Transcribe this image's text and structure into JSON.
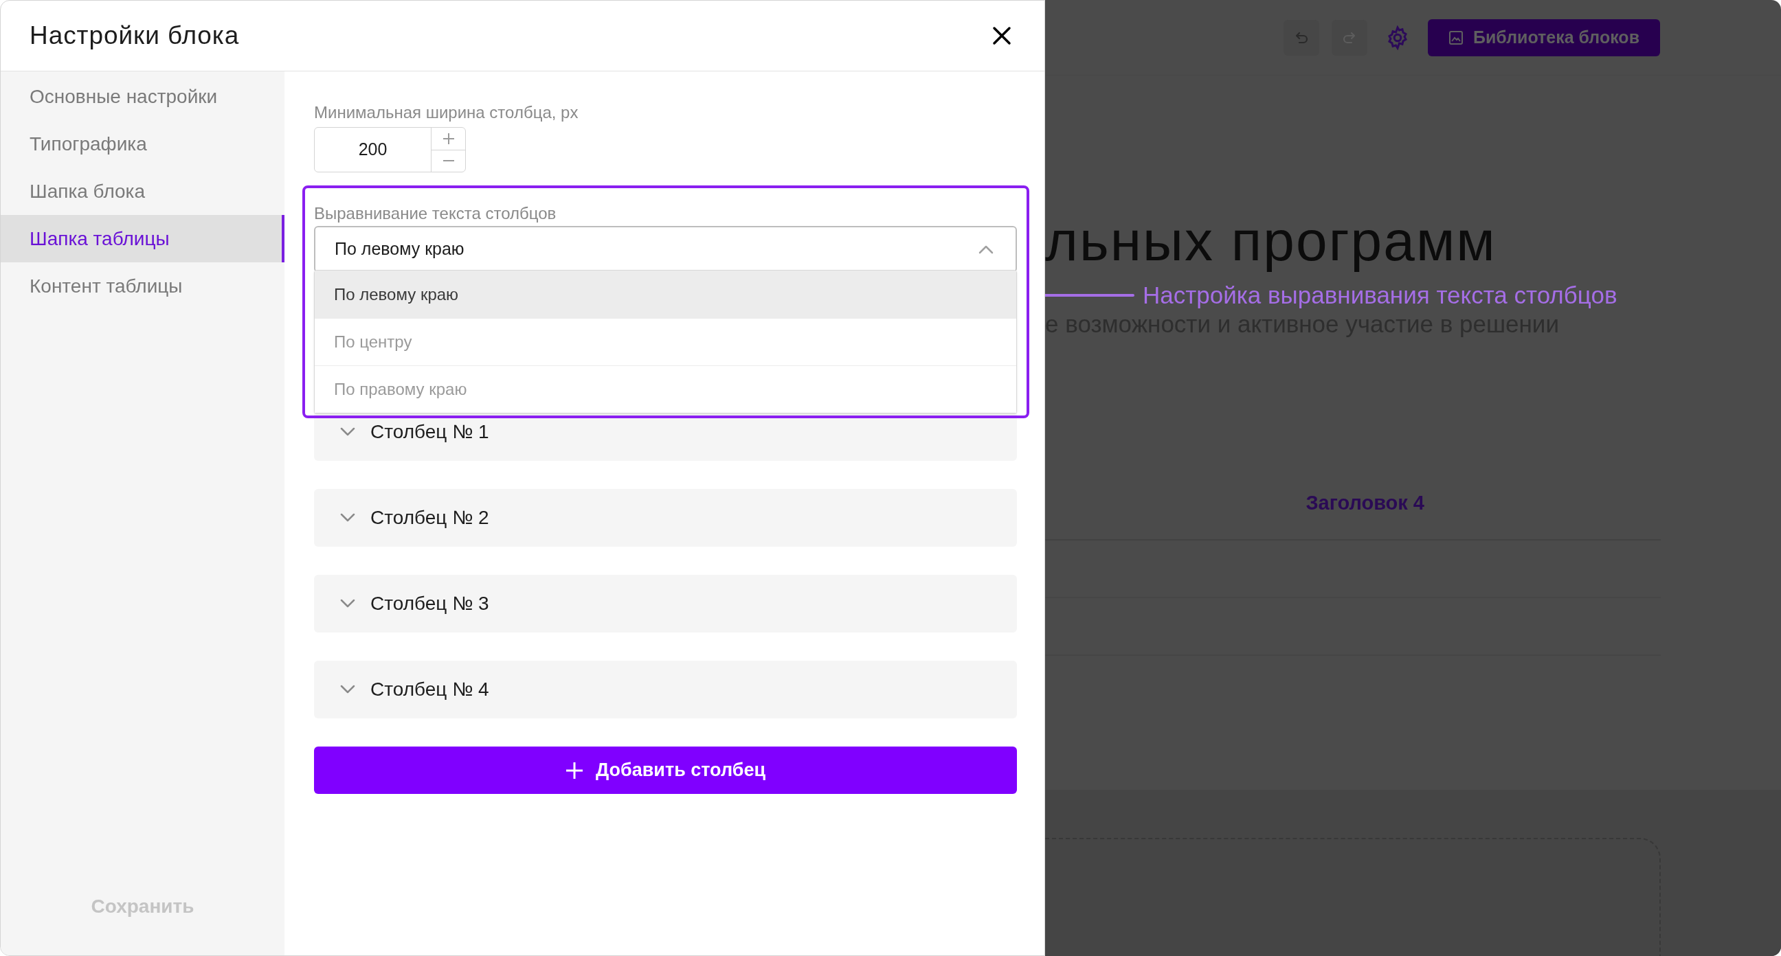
{
  "dialog": {
    "title": "Настройки блока"
  },
  "sidebar": {
    "items": [
      {
        "label": "Основные настройки",
        "selected": false
      },
      {
        "label": "Типографика",
        "selected": false
      },
      {
        "label": "Шапка блока",
        "selected": false
      },
      {
        "label": "Шапка таблицы",
        "selected": true
      },
      {
        "label": "Контент таблицы",
        "selected": false
      }
    ],
    "save_button": "Сохранить"
  },
  "min_width": {
    "label": "Минимальная ширина столбца, px",
    "value": "200"
  },
  "alignment": {
    "label": "Выравнивание текста столбцов",
    "value": "По левому краю",
    "expanded": true,
    "options": [
      {
        "label": "По левому краю",
        "selected": true
      },
      {
        "label": "По центру",
        "selected": false
      },
      {
        "label": "По правому краю",
        "selected": false
      }
    ]
  },
  "columns": [
    {
      "title": "Столбец № 1",
      "expanded": false
    },
    {
      "title": "Столбец № 2",
      "expanded": false
    },
    {
      "title": "Столбец № 3",
      "expanded": false
    },
    {
      "title": "Столбец № 4",
      "expanded": false
    }
  ],
  "add_column_button": "Добавить столбец",
  "annotation": "Настройка выравнивания текста столбцов",
  "background_page": {
    "toolbar": [
      {
        "kind": "undo",
        "disabled": false
      },
      {
        "kind": "redo",
        "disabled": true
      }
    ],
    "library_button": "Библиотека блоков",
    "heading": "льных программ",
    "subtitle": "е возможности и активное участие в решении",
    "table_header": "Заголовок 4"
  }
}
